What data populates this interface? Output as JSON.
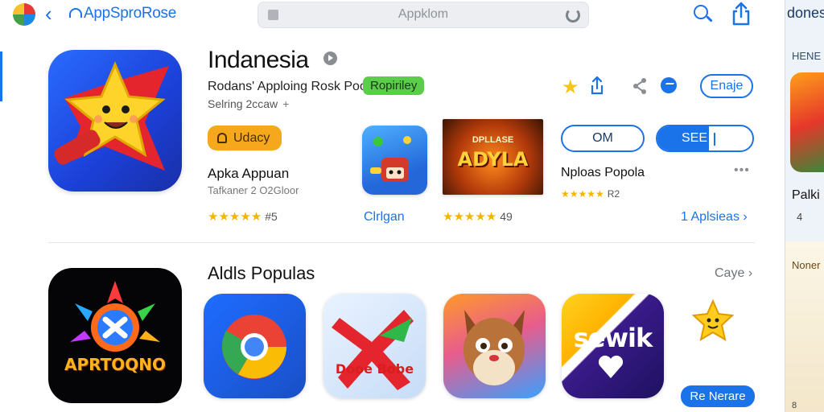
{
  "topbar": {
    "brand": "AppSproRose",
    "search_placeholder": "Appklom"
  },
  "app": {
    "title": "Indanesia",
    "subtitle": "Rodans' Apploing Rosk Poor",
    "tag": "Ropiriley",
    "meta": "Selring 2ccaw",
    "meta_plus": "+",
    "action_button": "Enaje"
  },
  "cards": {
    "pill": "Udacy",
    "card1_name": "Apka Appuan",
    "card1_sub": "Tafkaner 2 O2Gloor",
    "card1_stars": "★★★★★",
    "card1_rating": "#5",
    "link_middle": "Clrlgan",
    "card2_stars": "★★★★★",
    "card2_rating": "49",
    "thumb2_small": "DPLLASE",
    "thumb2_big": "ADYLA",
    "segment_left": "OM",
    "segment_right": "SEE",
    "card3_name": "Nploas Popola",
    "card3_stars": "★★★★★",
    "card3_rating": "R2",
    "dots": "•••",
    "link_right": "1 Aplsieas"
  },
  "popular": {
    "title": "Aldls Populas",
    "see_all": "Caye",
    "tile_big_word": "APRTOQNO",
    "tile_red_word": "Dooe Bobe",
    "tile_sewik_word": "sewik",
    "button": "Re Nerare"
  },
  "right_panel": {
    "title": "donest",
    "sub": "HENE",
    "name": "Palki",
    "num": "4",
    "label": "Noner",
    "tail": "8"
  },
  "colors": {
    "accent": "#1a73e8",
    "green_tag": "#5ccd4b",
    "orange_pill": "#f5a81c",
    "star": "#f5b400"
  },
  "icons": [
    "logo",
    "back-chevron",
    "search",
    "reload",
    "share",
    "star",
    "upload",
    "share-nodes",
    "messenger",
    "more-dots",
    "chevron-right"
  ]
}
